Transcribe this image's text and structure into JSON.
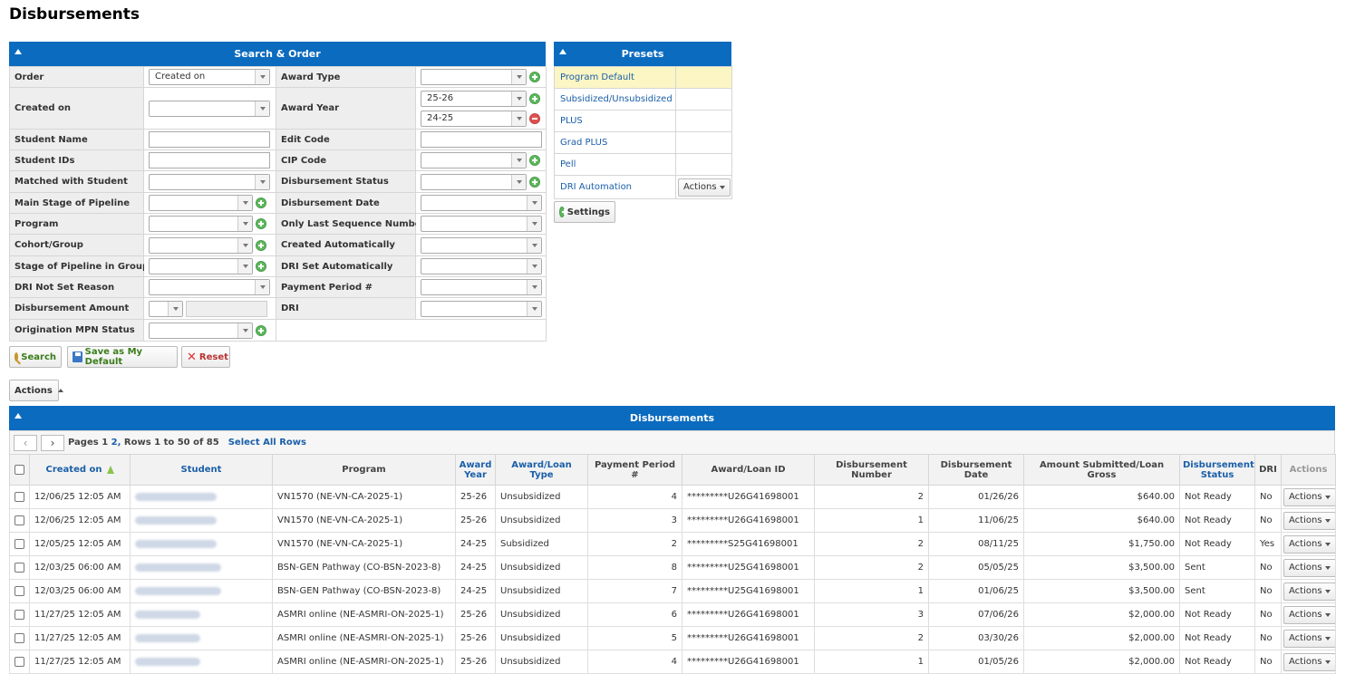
{
  "page": {
    "title": "Disbursements"
  },
  "search_panel": {
    "title": "Search & Order",
    "rows": [
      {
        "l_label": "Order",
        "l_value": "Created on",
        "r_label": "Award Type",
        "r_value": ""
      },
      {
        "l_label": "Created on",
        "l_value": "",
        "r_label": "Award Year",
        "r_value": "25-26",
        "r_value2": "24-25"
      },
      {
        "l_label": "Student Name",
        "r_label": "Edit Code"
      },
      {
        "l_label": "Student IDs",
        "r_label": "CIP Code"
      },
      {
        "l_label": "Matched with Student",
        "r_label": "Disbursement Status"
      },
      {
        "l_label": "Main Stage of Pipeline",
        "r_label": "Disbursement Date"
      },
      {
        "l_label": "Program",
        "r_label": "Only Last Sequence Number"
      },
      {
        "l_label": "Cohort/Group",
        "r_label": "Created Automatically"
      },
      {
        "l_label": "Stage of Pipeline in Group",
        "r_label": "DRI Set Automatically"
      },
      {
        "l_label": "DRI Not Set Reason",
        "r_label": "Payment Period #"
      },
      {
        "l_label": "Disbursement Amount",
        "r_label": "DRI"
      },
      {
        "l_label": "Origination MPN Status"
      }
    ],
    "buttons": {
      "search": "Search",
      "save_default": "Save as My Default",
      "reset": "Reset"
    }
  },
  "presets": {
    "title": "Presets",
    "items": [
      "Program Default",
      "Subsidized/Unsubsidized",
      "PLUS",
      "Grad PLUS",
      "Pell",
      "DRI Automation"
    ],
    "actions_label": "Actions",
    "settings_label": "Settings"
  },
  "actions_menu": {
    "label": "Actions"
  },
  "grid": {
    "title": "Disbursements",
    "pager": {
      "prefix": "Pages",
      "page1": "1",
      "page2": "2,",
      "rows": "Rows 1 to 50 of 85",
      "select_all": "Select All Rows"
    },
    "columns": [
      "Created on",
      "Student",
      "Program",
      "Award Year",
      "Award/Loan Type",
      "Payment Period #",
      "Award/Loan ID",
      "Disbursement Number",
      "Disbursement Date",
      "Amount Submitted/Loan Gross",
      "Disbursement Status",
      "DRI",
      "Actions"
    ],
    "row_action_label": "Actions",
    "rows": [
      {
        "created": "12/06/25 12:05 AM",
        "program": "VN1570 (NE-VN-CA-2025-1)",
        "year": "25-26",
        "type": "Unsubsidized",
        "period": "4",
        "loan_id": "*********U26G41698001",
        "disb_num": "2",
        "disb_date": "01/26/26",
        "amount": "$640.00",
        "status": "Not Ready",
        "dri": "No"
      },
      {
        "created": "12/06/25 12:05 AM",
        "program": "VN1570 (NE-VN-CA-2025-1)",
        "year": "25-26",
        "type": "Unsubsidized",
        "period": "3",
        "loan_id": "*********U26G41698001",
        "disb_num": "1",
        "disb_date": "11/06/25",
        "amount": "$640.00",
        "status": "Not Ready",
        "dri": "No"
      },
      {
        "created": "12/05/25 12:05 AM",
        "program": "VN1570 (NE-VN-CA-2025-1)",
        "year": "24-25",
        "type": "Subsidized",
        "period": "2",
        "loan_id": "*********S25G41698001",
        "disb_num": "2",
        "disb_date": "08/11/25",
        "amount": "$1,750.00",
        "status": "Not Ready",
        "dri": "Yes"
      },
      {
        "created": "12/03/25 06:00 AM",
        "program": "BSN-GEN Pathway (CO-BSN-2023-8)",
        "year": "24-25",
        "type": "Unsubsidized",
        "period": "8",
        "loan_id": "*********U25G41698001",
        "disb_num": "2",
        "disb_date": "05/05/25",
        "amount": "$3,500.00",
        "status": "Sent",
        "dri": "No"
      },
      {
        "created": "12/03/25 06:00 AM",
        "program": "BSN-GEN Pathway (CO-BSN-2023-8)",
        "year": "24-25",
        "type": "Unsubsidized",
        "period": "7",
        "loan_id": "*********U25G41698001",
        "disb_num": "1",
        "disb_date": "01/06/25",
        "amount": "$3,500.00",
        "status": "Sent",
        "dri": "No"
      },
      {
        "created": "11/27/25 12:05 AM",
        "program": "ASMRI online (NE-ASMRI-ON-2025-1)",
        "year": "25-26",
        "type": "Unsubsidized",
        "period": "6",
        "loan_id": "*********U26G41698001",
        "disb_num": "3",
        "disb_date": "07/06/26",
        "amount": "$2,000.00",
        "status": "Not Ready",
        "dri": "No"
      },
      {
        "created": "11/27/25 12:05 AM",
        "program": "ASMRI online (NE-ASMRI-ON-2025-1)",
        "year": "25-26",
        "type": "Unsubsidized",
        "period": "5",
        "loan_id": "*********U26G41698001",
        "disb_num": "2",
        "disb_date": "03/30/26",
        "amount": "$2,000.00",
        "status": "Not Ready",
        "dri": "No"
      },
      {
        "created": "11/27/25 12:05 AM",
        "program": "ASMRI online (NE-ASMRI-ON-2025-1)",
        "year": "25-26",
        "type": "Unsubsidized",
        "period": "4",
        "loan_id": "*********U26G41698001",
        "disb_num": "1",
        "disb_date": "01/05/26",
        "amount": "$2,000.00",
        "status": "Not Ready",
        "dri": "No"
      }
    ]
  }
}
